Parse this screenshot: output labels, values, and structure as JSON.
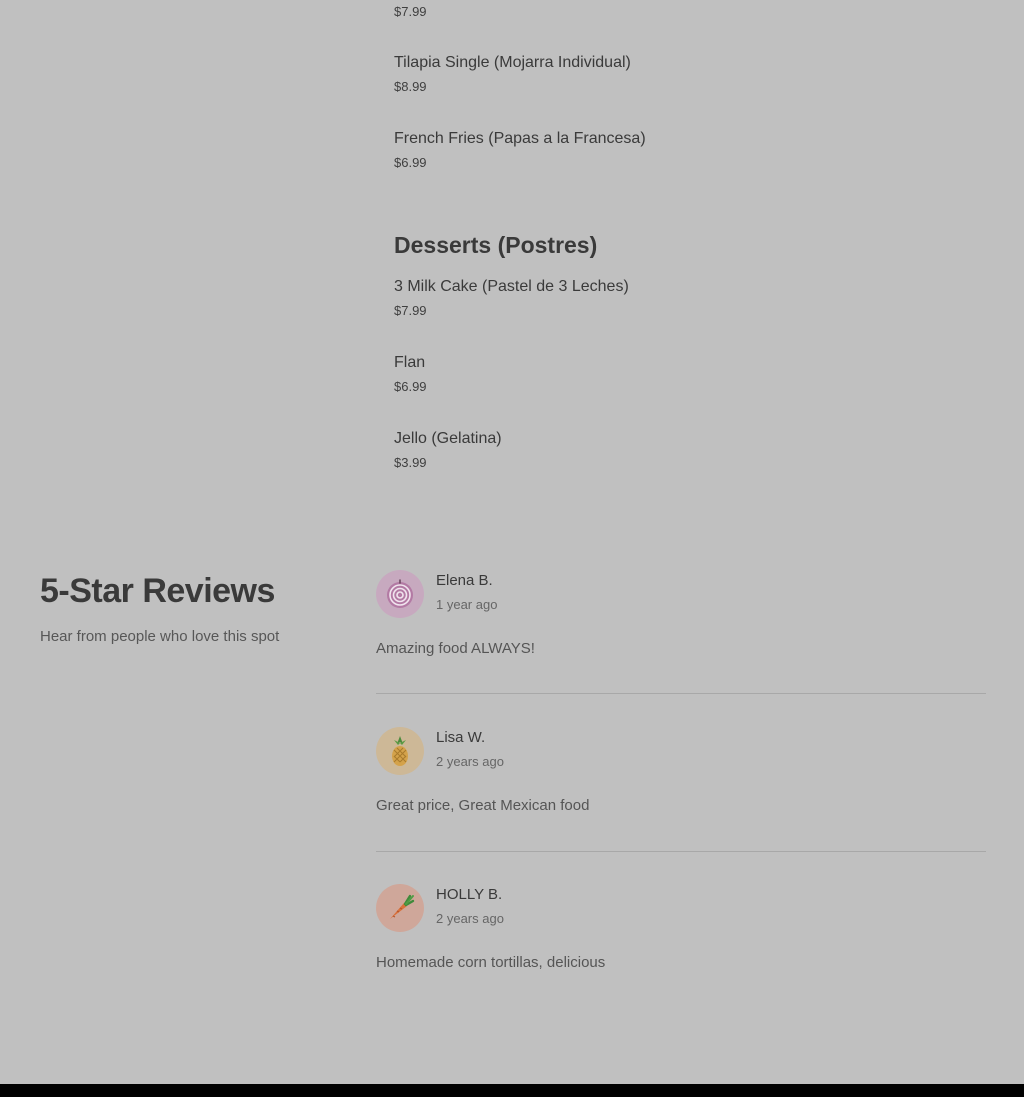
{
  "menu": {
    "items_top": [
      {
        "name": "",
        "price": "$7.99"
      },
      {
        "name": "Tilapia Single (Mojarra Individual)",
        "price": "$8.99"
      },
      {
        "name": "French Fries (Papas a la Francesa)",
        "price": "$6.99"
      }
    ],
    "desserts": {
      "title": "Desserts (Postres)",
      "items": [
        {
          "name": "3 Milk Cake (Pastel de 3 Leches)",
          "price": "$7.99"
        },
        {
          "name": "Flan",
          "price": "$6.99"
        },
        {
          "name": "Jello (Gelatina)",
          "price": "$3.99"
        }
      ]
    }
  },
  "reviews": {
    "title": "5-Star Reviews",
    "subtitle": "Hear from people who love this spot",
    "list": [
      {
        "name": "Elena B.",
        "time": "1 year ago",
        "text": "Amazing food ALWAYS!",
        "avatar_icon": "onion-icon",
        "avatar_color": "#c7a9bf"
      },
      {
        "name": "Lisa W.",
        "time": "2 years ago",
        "text": "Great price, Great Mexican food",
        "avatar_icon": "pineapple-icon",
        "avatar_color": "#cdb897"
      },
      {
        "name": "HOLLY B.",
        "time": "2 years ago",
        "text": "Homemade corn tortillas, delicious",
        "avatar_icon": "carrot-icon",
        "avatar_color": "#cfa79a"
      }
    ]
  },
  "colors": {
    "background": "#c0c0c0",
    "footer": "#000000"
  }
}
